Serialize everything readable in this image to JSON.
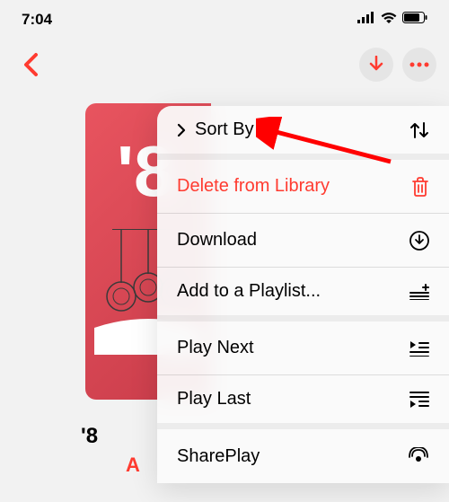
{
  "status_bar": {
    "time": "7:04"
  },
  "nav": {
    "back": "Back"
  },
  "album": {
    "title": "'8",
    "artist_prefix": "A",
    "art_number": "'8"
  },
  "menu": {
    "sort_by": "Sort By",
    "delete": "Delete from Library",
    "download": "Download",
    "add_playlist": "Add to a Playlist...",
    "play_next": "Play Next",
    "play_last": "Play Last",
    "shareplay": "SharePlay"
  },
  "colors": {
    "accent": "#ff3b30",
    "destructive": "#ff3b30"
  }
}
